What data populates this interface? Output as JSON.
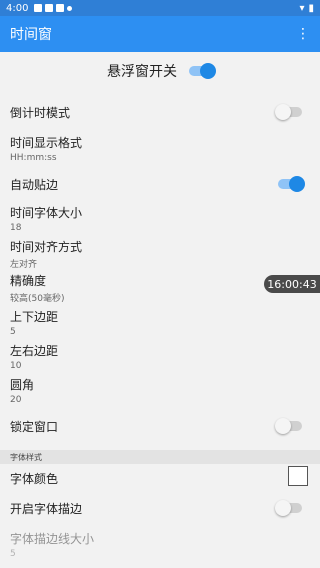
{
  "statusbar": {
    "time": "4:00"
  },
  "appbar": {
    "title": "时间窗",
    "menu_icon": "more-vert-icon"
  },
  "master": {
    "label": "悬浮窗开关",
    "enabled": true
  },
  "settings": [
    {
      "title": "倒计时模式",
      "switch": false
    },
    {
      "title": "时间显示格式",
      "subtitle": "HH:mm:ss"
    },
    {
      "title": "自动贴边",
      "switch": true
    },
    {
      "title": "时间字体大小",
      "subtitle": "18"
    },
    {
      "title": "时间对齐方式",
      "subtitle": "左对齐"
    },
    {
      "title": "精确度",
      "subtitle": "较高(50毫秒)"
    },
    {
      "title": "上下边距",
      "subtitle": "5"
    },
    {
      "title": "左右边距",
      "subtitle": "10"
    },
    {
      "title": "圆角",
      "subtitle": "20"
    },
    {
      "title": "锁定窗口",
      "switch": false
    }
  ],
  "font_section": {
    "header": "字体样式",
    "font_color": {
      "title": "字体颜色",
      "color": "#ffffff"
    },
    "stroke_enable": {
      "title": "开启字体描边",
      "switch": false
    },
    "stroke_size": {
      "title": "字体描边线大小",
      "subtitle": "5"
    }
  },
  "floating_time": "16:00:43",
  "colors": {
    "appbar": "#2d8ff2",
    "accent": "#1e88e5",
    "statusbar": "#2f7fd6"
  }
}
